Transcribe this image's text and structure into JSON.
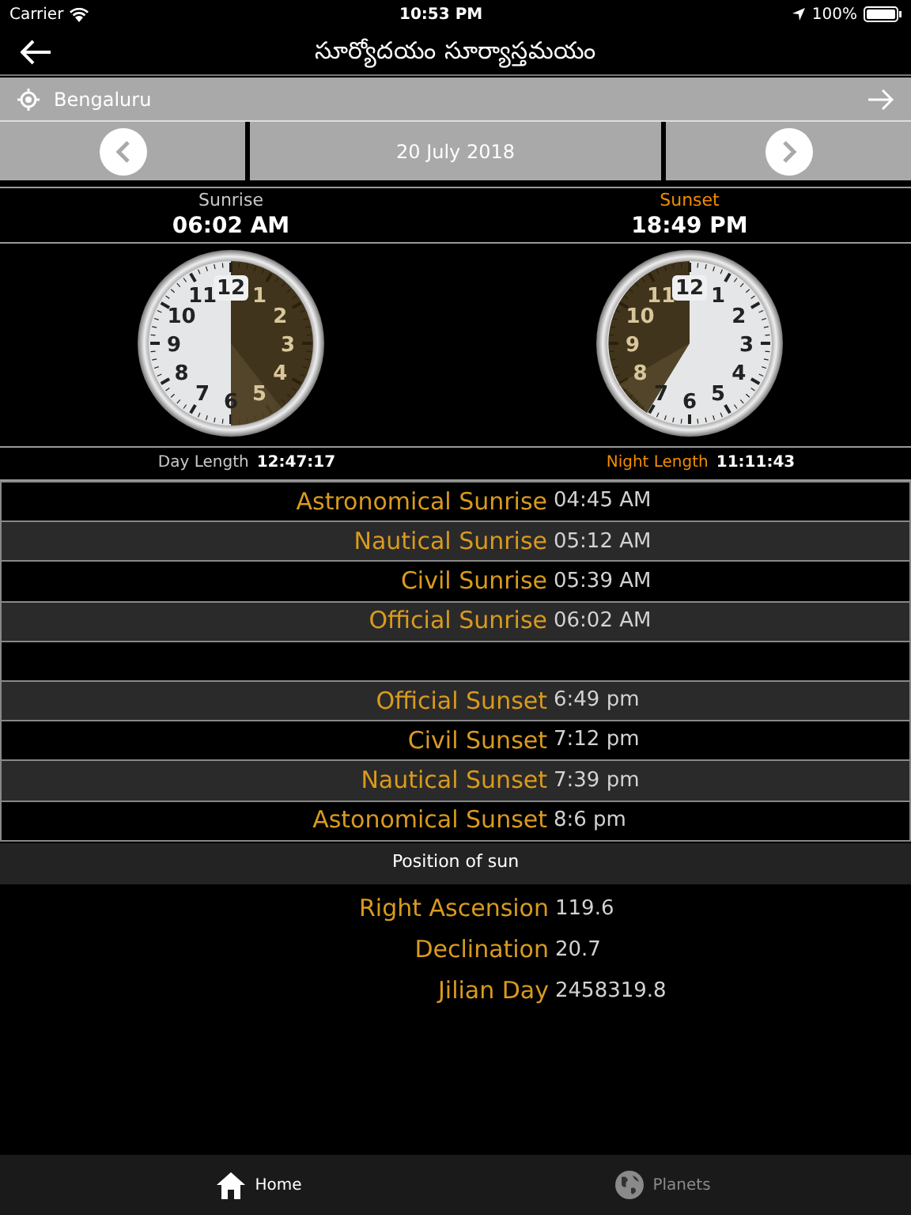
{
  "status_bar": {
    "carrier": "Carrier",
    "time": "10:53 PM",
    "battery": "100%"
  },
  "nav_bar": {
    "title": "సూర్యోదయం సూర్యాస్తమయం"
  },
  "location": {
    "name": "Bengaluru"
  },
  "date_bar": {
    "date": "20 July 2018"
  },
  "clocks": [
    {
      "kind": "sunrise",
      "label": "Sunrise",
      "color": "#c8c8c8",
      "time": "06:02 AM",
      "numerals": [
        "11",
        "12",
        "1",
        "10",
        "2",
        "9",
        "3",
        "8",
        "4",
        "7",
        "6",
        "5"
      ],
      "length_label": "Day Length",
      "length": "12:47:17"
    },
    {
      "kind": "sunset",
      "label": "Sunset",
      "color": "#f08c00",
      "time": "18:49 PM",
      "numerals": [
        "11",
        "12",
        "1",
        "10",
        "2",
        "9",
        "3",
        "8",
        "4",
        "7",
        "6",
        "5"
      ],
      "length_label": "Night Length",
      "length": "11:11:43"
    }
  ],
  "times": [
    {
      "kind": "time",
      "label": "Astronomical Sunrise",
      "value": "04:45 AM"
    },
    {
      "kind": "time",
      "label": "Nautical Sunrise",
      "value": "05:12 AM"
    },
    {
      "kind": "time",
      "label": "Civil Sunrise",
      "value": "05:39 AM"
    },
    {
      "kind": "time",
      "label": "Official Sunrise",
      "value": "06:02 AM"
    },
    {
      "kind": "spacer"
    },
    {
      "kind": "time",
      "label": "Official Sunset",
      "value": "6:49 pm"
    },
    {
      "kind": "time",
      "label": "Civil Sunset",
      "value": "7:12 pm"
    },
    {
      "kind": "time",
      "label": "Nautical Sunset",
      "value": "7:39 pm"
    },
    {
      "kind": "time",
      "label": "Astonomical Sunset",
      "value": "8:6 pm"
    }
  ],
  "position": {
    "title": "Position of sun",
    "rows": [
      {
        "label": "Right Ascension",
        "value": "119.6"
      },
      {
        "label": "Declination",
        "value": "20.7"
      },
      {
        "label": "Jilian Day",
        "value": "2458319.8"
      }
    ]
  },
  "tab_bar": [
    {
      "label": "Home",
      "kind": "home",
      "selected": true
    },
    {
      "label": "Planets",
      "kind": "globe",
      "selected": false
    }
  ]
}
